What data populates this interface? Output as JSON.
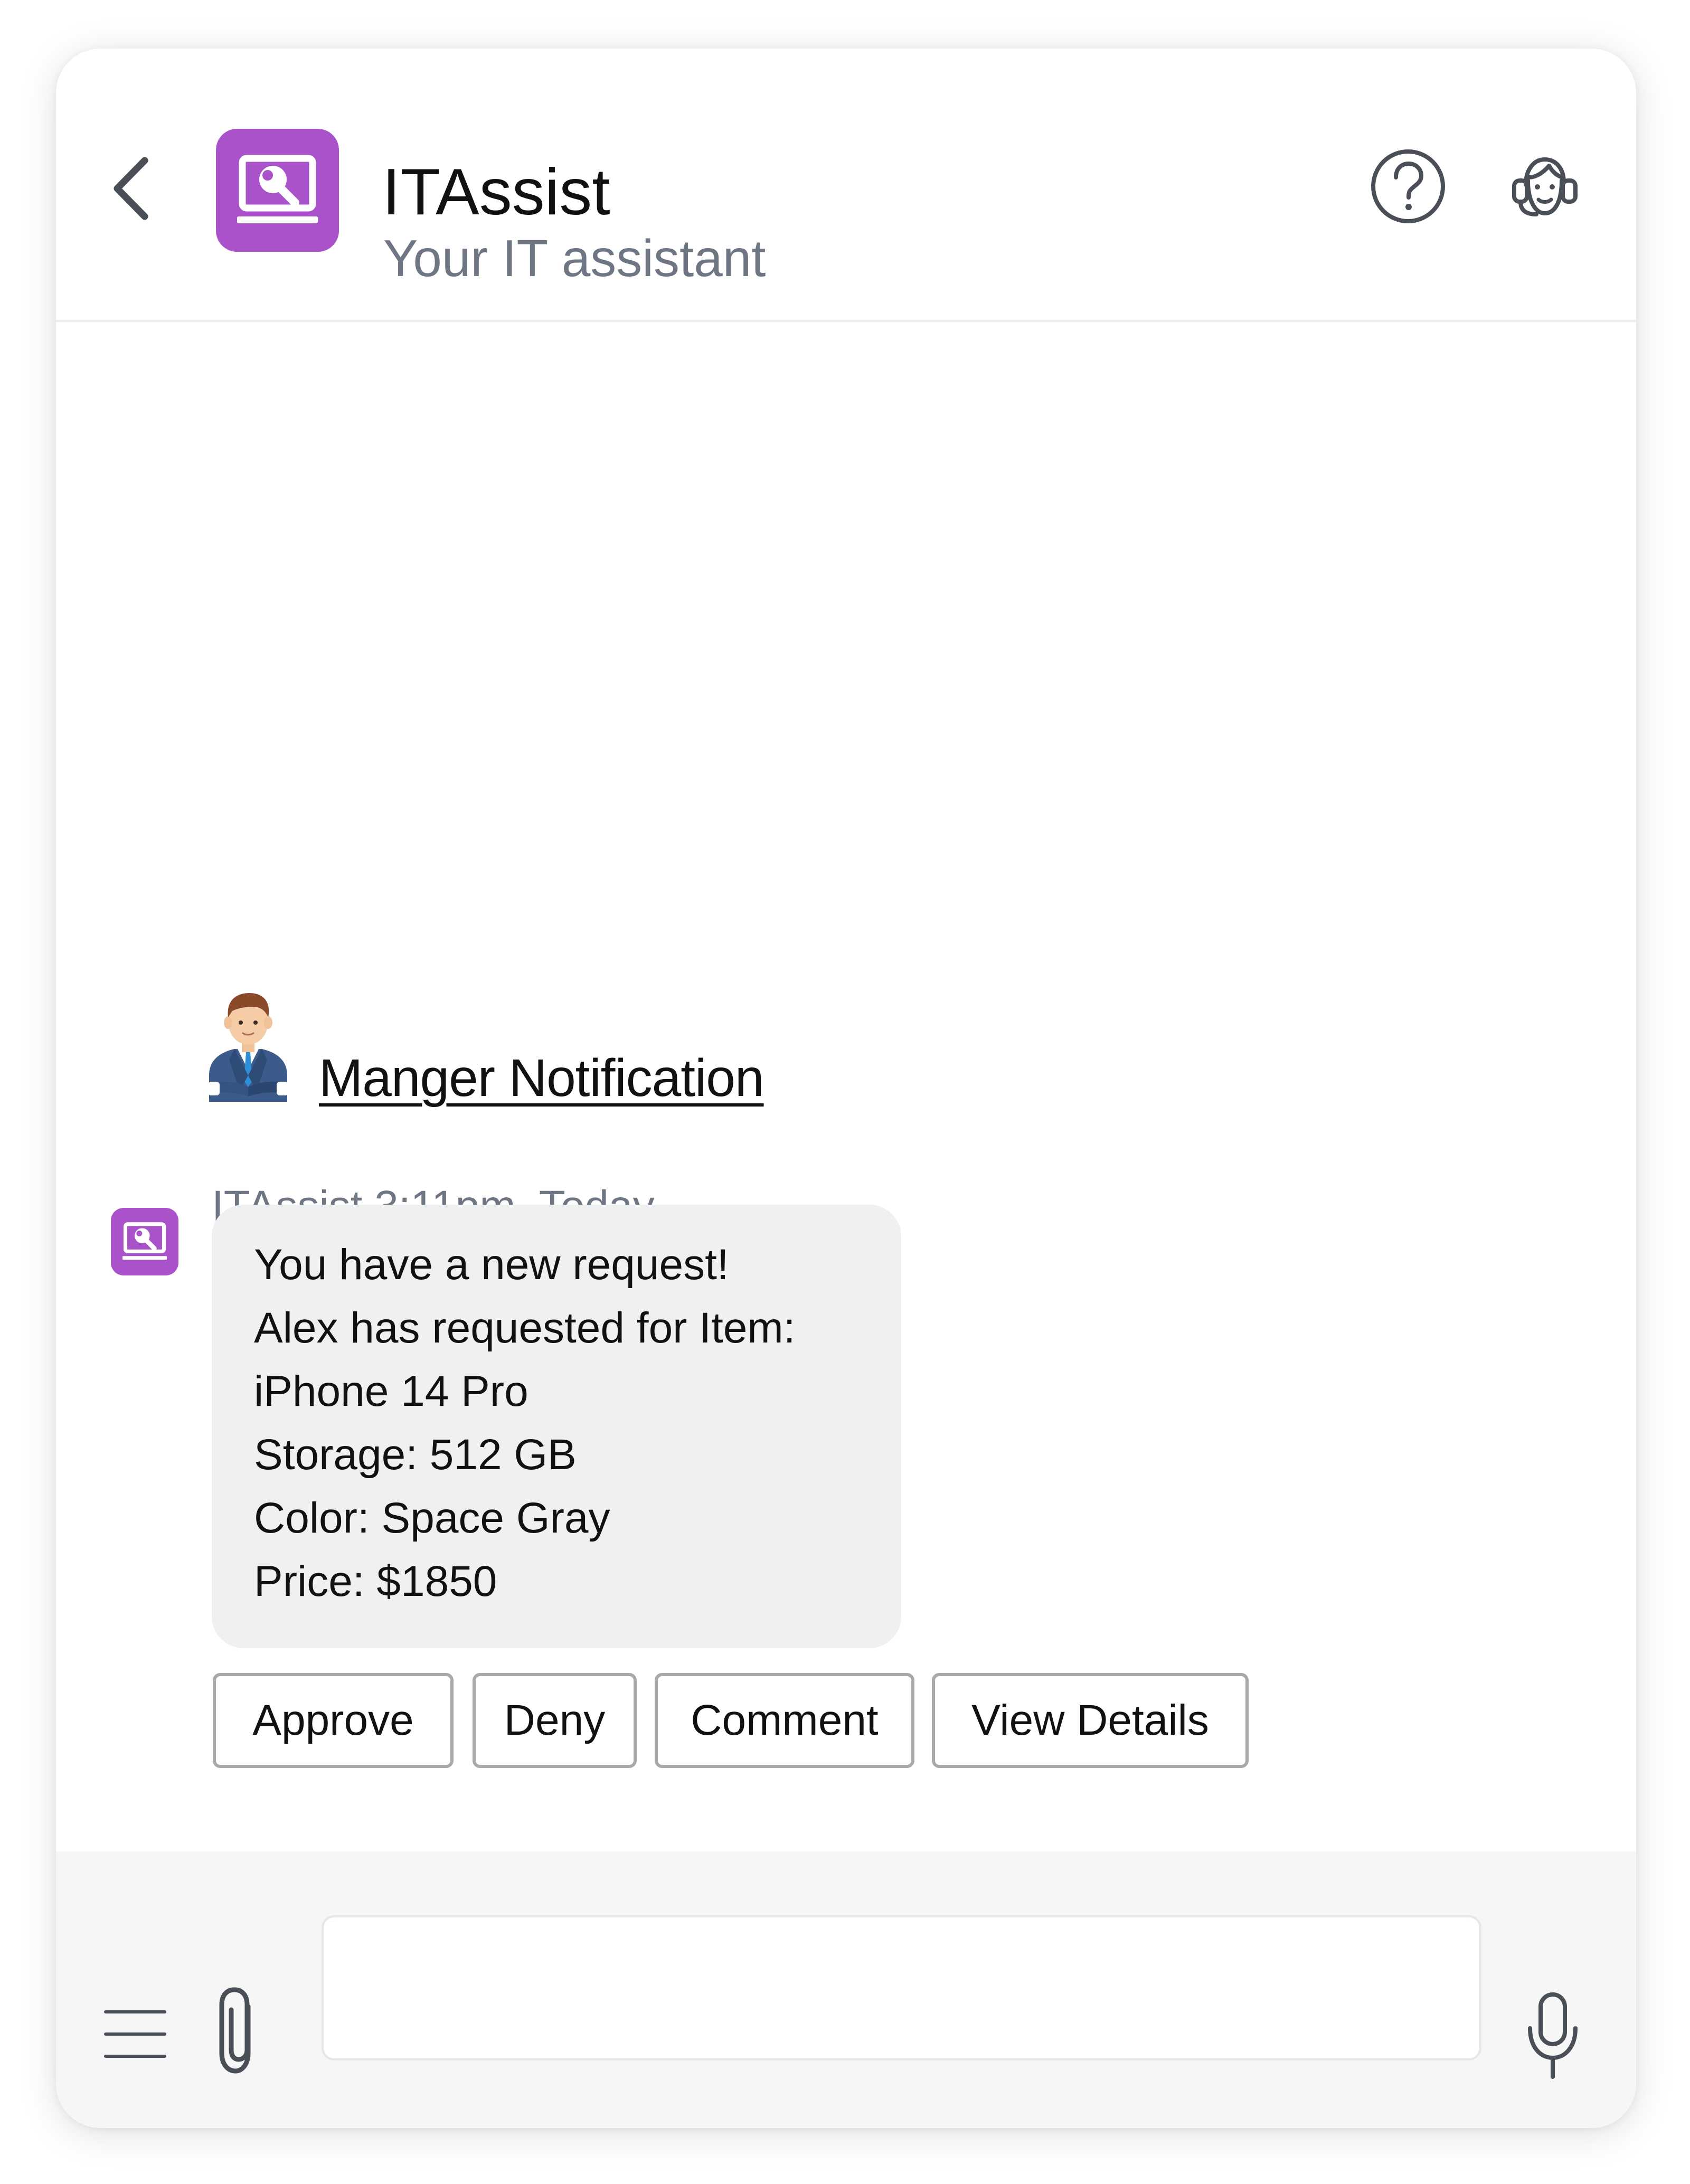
{
  "header": {
    "title": "ITAssist",
    "subtitle": "Your IT assistant",
    "icons": {
      "back": "chevron-left-icon",
      "logo": "laptop-wrench-icon",
      "help": "question-circle-icon",
      "agent": "live-agent-icon"
    },
    "brand_color": "#aa52c9"
  },
  "conversation": {
    "notification": {
      "avatar": "manager-avatar",
      "link_text": "Manger Notification"
    },
    "message": {
      "meta": "ITAssist 3:11pm, Today",
      "lines": [
        "You have a new request!",
        "Alex has requested for Item:",
        "iPhone 14 Pro",
        "Storage: 512 GB",
        "Color: Space Gray",
        "Price: $1850"
      ]
    },
    "actions": [
      {
        "label": "Approve"
      },
      {
        "label": "Deny"
      },
      {
        "label": "Comment"
      },
      {
        "label": "View Details"
      }
    ]
  },
  "composer": {
    "input_value": "",
    "placeholder": "",
    "icons": {
      "menu": "hamburger-menu-icon",
      "attach": "paperclip-icon",
      "mic": "microphone-icon"
    }
  }
}
